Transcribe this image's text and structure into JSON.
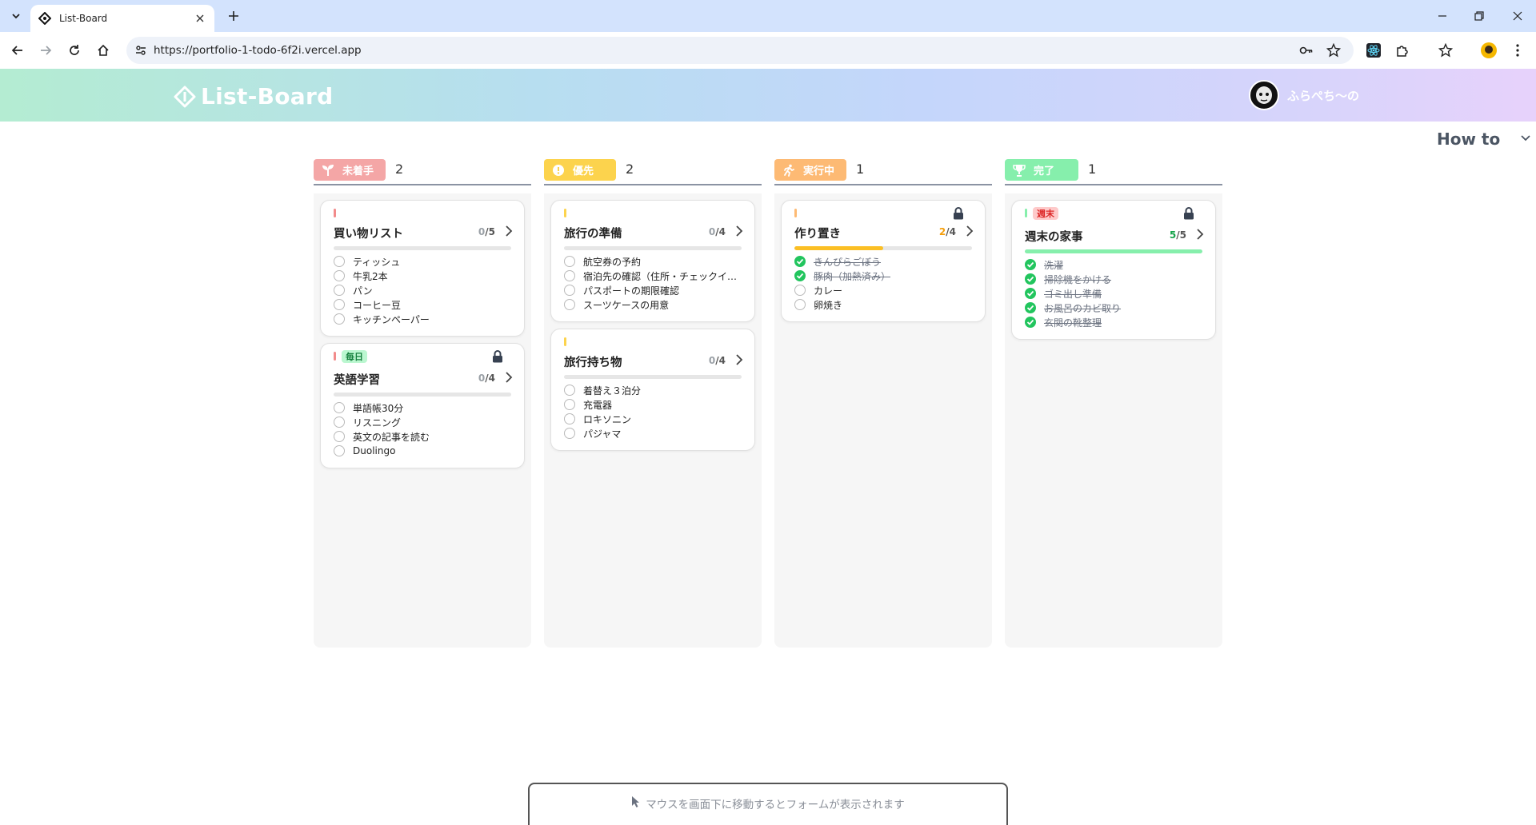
{
  "browser": {
    "tab_title": "List-Board",
    "url": "https://portfolio-1-todo-6f2i.vercel.app"
  },
  "app": {
    "brand": "List-Board",
    "user_name": "ふらぺち〜の",
    "howto_label": "How to",
    "form_hint": "マウスを画面下に移動するとフォームが表示されます"
  },
  "columns": [
    {
      "label": "未着手",
      "count": "2",
      "color": "#f4a6a6",
      "icon": "sprout-icon",
      "cards": [
        {
          "title": "買い物リスト",
          "done": "0",
          "total": "/5",
          "marker_color": "#f28b8b",
          "tag": "",
          "locked": false,
          "progress": 0,
          "items": [
            {
              "text": "ティッシュ",
              "checked": false
            },
            {
              "text": "牛乳2本",
              "checked": false
            },
            {
              "text": "パン",
              "checked": false
            },
            {
              "text": "コーヒー豆",
              "checked": false
            },
            {
              "text": "キッチンペーパー",
              "checked": false
            }
          ]
        },
        {
          "title": "英語学習",
          "done": "0",
          "total": "/4",
          "marker_color": "#f28b8b",
          "tag": "毎日",
          "locked": true,
          "progress": 0,
          "items": [
            {
              "text": "単語帳30分",
              "checked": false
            },
            {
              "text": "リスニング",
              "checked": false
            },
            {
              "text": "英文の記事を読む",
              "checked": false
            },
            {
              "text": "Duolingo",
              "checked": false
            }
          ]
        }
      ]
    },
    {
      "label": "優先",
      "count": "2",
      "color": "#fcd34d",
      "icon": "alert-icon",
      "cards": [
        {
          "title": "旅行の準備",
          "done": "0",
          "total": "/4",
          "marker_color": "#fcd34d",
          "tag": "",
          "locked": false,
          "progress": 0,
          "items": [
            {
              "text": "航空券の予約",
              "checked": false
            },
            {
              "text": "宿泊先の確認（住所・チェックイ…",
              "checked": false
            },
            {
              "text": "パスポートの期限確認",
              "checked": false
            },
            {
              "text": "スーツケースの用意",
              "checked": false
            }
          ]
        },
        {
          "title": "旅行持ち物",
          "done": "0",
          "total": "/4",
          "marker_color": "#fcd34d",
          "tag": "",
          "locked": false,
          "progress": 0,
          "items": [
            {
              "text": "着替え３泊分",
              "checked": false
            },
            {
              "text": "充電器",
              "checked": false
            },
            {
              "text": "ロキソニン",
              "checked": false
            },
            {
              "text": "パジャマ",
              "checked": false
            }
          ]
        }
      ]
    },
    {
      "label": "実行中",
      "count": "1",
      "color": "#fdba74",
      "icon": "running-icon",
      "cards": [
        {
          "title": "作り置き",
          "done": "2",
          "total": "/4",
          "marker_color": "#fdba74",
          "tag": "",
          "locked": true,
          "progress": 0.5,
          "progress_color": "#fbbf24",
          "done_color": "#f59e0b",
          "items": [
            {
              "text": "きんぴらごぼう",
              "checked": true
            },
            {
              "text": "豚肉（加熱済み）",
              "checked": true
            },
            {
              "text": "カレー",
              "checked": false
            },
            {
              "text": "卵焼き",
              "checked": false
            }
          ]
        }
      ]
    },
    {
      "label": "完了",
      "count": "1",
      "color": "#86efac",
      "icon": "trophy-icon",
      "cards": [
        {
          "title": "週末の家事",
          "done": "5",
          "total": "/5",
          "marker_color": "#86efac",
          "tag": "週末",
          "locked": true,
          "progress": 1,
          "progress_color": "#86efac",
          "done_color": "#16a34a",
          "items": [
            {
              "text": "洗濯",
              "checked": true
            },
            {
              "text": "掃除機をかける",
              "checked": true
            },
            {
              "text": "ゴミ出し準備",
              "checked": true
            },
            {
              "text": "お風呂のカビ取り",
              "checked": true
            },
            {
              "text": "玄関の靴整理",
              "checked": true
            }
          ]
        }
      ]
    }
  ]
}
